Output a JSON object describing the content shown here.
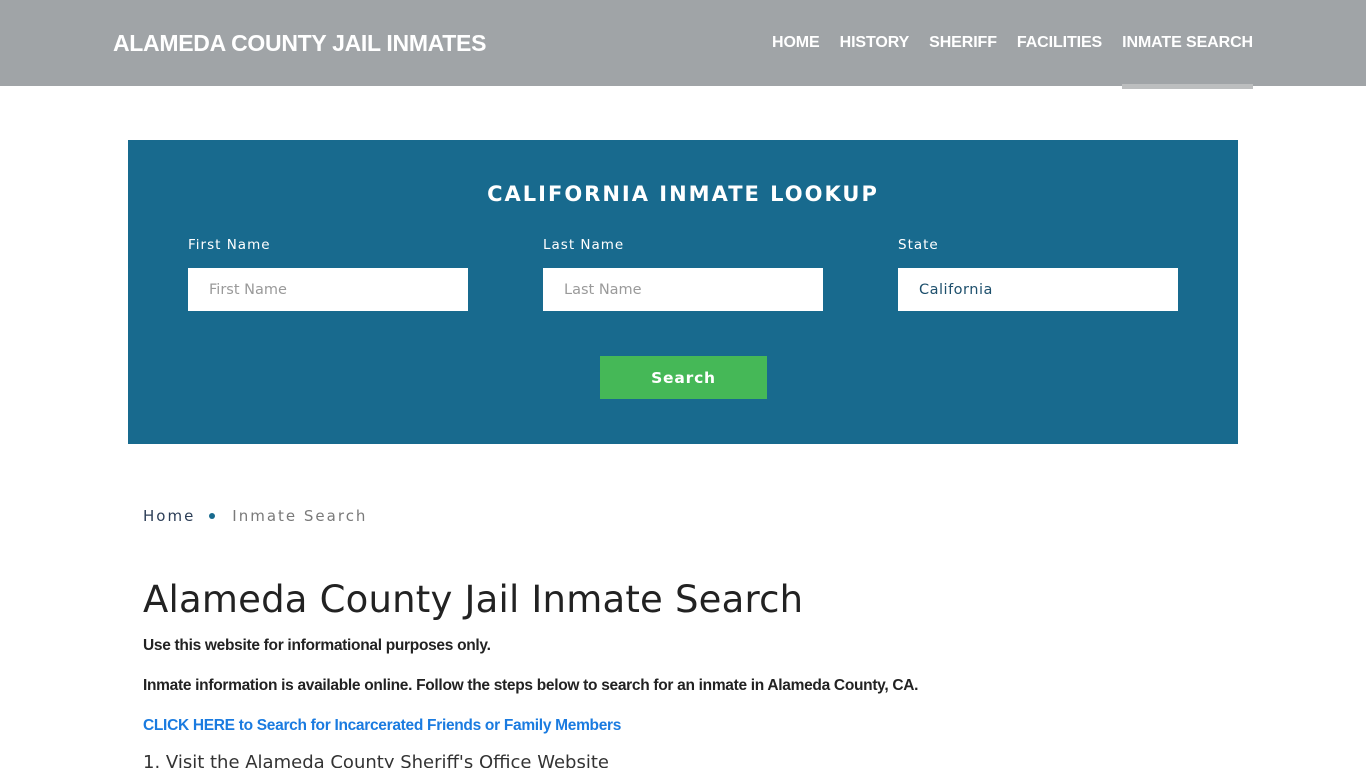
{
  "header": {
    "brand": "ALAMEDA COUNTY JAIL INMATES",
    "nav": [
      {
        "label": "HOME",
        "active": false
      },
      {
        "label": "HISTORY",
        "active": false
      },
      {
        "label": "SHERIFF",
        "active": false
      },
      {
        "label": "FACILITIES",
        "active": false
      },
      {
        "label": "INMATE SEARCH",
        "active": true
      }
    ]
  },
  "lookup": {
    "title": "CALIFORNIA INMATE LOOKUP",
    "fields": {
      "first_name": {
        "label": "First Name",
        "placeholder": "First Name",
        "value": ""
      },
      "last_name": {
        "label": "Last Name",
        "placeholder": "Last Name",
        "value": ""
      },
      "state": {
        "label": "State",
        "value": "California"
      }
    },
    "search_label": "Search"
  },
  "breadcrumb": {
    "home": "Home",
    "current": "Inmate Search"
  },
  "content": {
    "title": "Alameda County Jail Inmate Search",
    "paragraphs": [
      "Use this website for informational purposes only.",
      "Inmate information is available online. Follow the steps below to search for an inmate in Alameda County, CA."
    ],
    "cta_link": "CLICK HERE to Search for Incarcerated Friends or Family Members",
    "steps": [
      "1. Visit the Alameda County Sheriff's Office Website"
    ]
  },
  "colors": {
    "navbar": "#a0a4a7",
    "lookup_bg": "#186a8e",
    "search_button": "#45b857",
    "link": "#1a7be0"
  }
}
